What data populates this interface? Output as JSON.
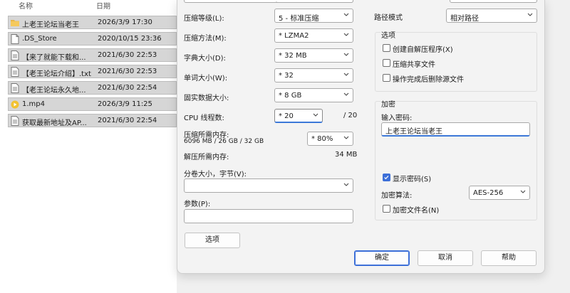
{
  "explorer": {
    "col_name": "名称",
    "col_date": "日期",
    "files": [
      {
        "icon": "folder-icon",
        "name": "上老王论坛当老王",
        "date": "2026/3/9 17:30"
      },
      {
        "icon": "file-icon",
        "name": ".DS_Store",
        "date": "2020/10/15 23:36"
      },
      {
        "icon": "text-file-icon",
        "name": "【来了就能下载和...",
        "date": "2021/6/30 22:53"
      },
      {
        "icon": "text-file-icon",
        "name": "【老王论坛介绍】.txt",
        "date": "2021/6/30 22:53"
      },
      {
        "icon": "text-file-icon",
        "name": "【老王论坛永久地...",
        "date": "2021/6/30 22:54"
      },
      {
        "icon": "video-file-icon",
        "name": "1.mp4",
        "date": "2026/3/9 11:25"
      },
      {
        "icon": "text-file-icon",
        "name": "获取最新地址及AP...",
        "date": "2021/6/30 22:54"
      }
    ]
  },
  "left": {
    "level_label": "压缩等级(L):",
    "level_value": "5 - 标准压缩",
    "method_label": "压缩方法(M):",
    "method_value": "* LZMA2",
    "dict_label": "字典大小(D):",
    "dict_value": "* 32 MB",
    "word_label": "单词大小(W):",
    "word_value": "* 32",
    "solid_label": "固实数据大小:",
    "solid_value": "* 8 GB",
    "cpu_label": "CPU 线程数:",
    "cpu_value": "* 20",
    "cpu_max": "/ 20",
    "mem_label": "压缩所需内存:",
    "mem_detail": "6096 MB / 26 GB / 32 GB",
    "mem_value": "* 80%",
    "decomp_label": "解压所需内存:",
    "decomp_value": "34 MB",
    "split_label": "分卷大小，字节(V):",
    "split_value": "",
    "params_label": "参数(P):",
    "params_value": "",
    "options_button": "选项"
  },
  "right": {
    "path_label": "路径模式",
    "path_value": "相对路径",
    "options_title": "选项",
    "opt_sfx": "创建自解压程序(X)",
    "opt_shared": "压缩共享文件",
    "opt_delete": "操作完成后删除源文件",
    "enc_title": "加密",
    "pw_label": "输入密码:",
    "pw_value": "上老王论坛当老王",
    "show_pw": "显示密码(S)",
    "algo_label": "加密算法:",
    "algo_value": "AES-256",
    "enc_names": "加密文件名(N)"
  },
  "footer": {
    "ok": "确定",
    "cancel": "取消",
    "help": "帮助"
  },
  "colors": {
    "accent": "#3c6fd8"
  }
}
